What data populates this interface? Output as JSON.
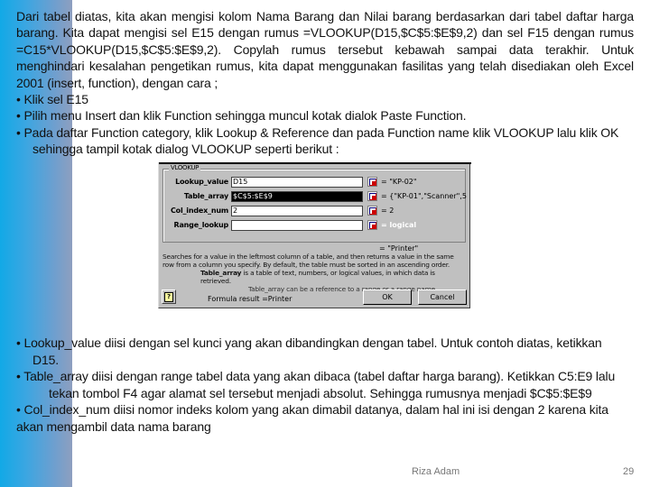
{
  "slide": {
    "top_text": [
      "Dari tabel diatas, kita akan mengisi kolom Nama Barang dan Nilai barang berdasarkan dari tabel daftar harga barang. Kita dapat mengisi sel E15 dengan rumus =VLOOKUP(D15,$C$5:$E$9,2) dan sel F15 dengan rumus =C15*VLOOKUP(D15,$C$5:$E$9,2). Copylah rumus tersebut kebawah sampai data terakhir. Untuk menghindari kesalahan pengetikan rumus, kita dapat menggunakan fasilitas yang telah disediakan oleh Excel 2001 (insert, function), dengan cara ;",
      "• Klik sel E15",
      "• Pilih menu Insert dan klik Function sehingga muncul kotak dialok Paste Function.",
      "• Pada daftar Function category, klik Lookup & Reference dan pada Function name klik VLOOKUP lalu klik OK",
      "sehingga tampil kotak dialog VLOOKUP seperti berikut :"
    ],
    "bottom_text": [
      "• Lookup_value diisi dengan sel kunci yang akan dibandingkan dengan tabel. Untuk contoh diatas, ketikkan",
      "D15.",
      "• Table_array diisi dengan range tabel data yang akan dibaca (tabel daftar harga barang). Ketikkan C5:E9 lalu",
      "tekan tombol F4 agar alamat sel tersebut menjadi absolut. Sehingga rumusnya menjadi $C$5:$E$9",
      "• Col_index_num diisi nomor indeks kolom yang akan dimabil datanya, dalam hal ini isi dengan 2 karena kita",
      "akan mengambil data nama barang"
    ],
    "footer": {
      "author": "Riza Adam",
      "page_number": "29"
    }
  },
  "dialog": {
    "group_title": "VLOOKUP",
    "args": [
      {
        "label": "Lookup_value",
        "value": "D15",
        "result": "= \"KP-02\"",
        "selected": false
      },
      {
        "label": "Table_array",
        "value": "$C$5:$E$9",
        "result": "= {\"KP-01\",\"Scanner\",5",
        "selected": true
      },
      {
        "label": "Col_index_num",
        "value": "2",
        "result": "= 2",
        "selected": false
      },
      {
        "label": "Range_lookup",
        "value": "",
        "result": "= logical",
        "selected": false
      }
    ],
    "formula_result_top": "= \"Printer\"",
    "description": "Searches for a value in the leftmost column of a table, and then returns a value in the same row from a column you specify. By default, the table must be sorted in an ascending order.",
    "arg_description_name": "Table_array",
    "arg_description": "is a table of text, numbers, or logical values, in which data is retrieved.",
    "arg_description_2": "Table_array can be a reference to a range or a range name.",
    "formula_result_bottom": "Formula result =Printer",
    "ok_label": "OK",
    "cancel_label": "Cancel",
    "help_icon_glyph": "?"
  }
}
